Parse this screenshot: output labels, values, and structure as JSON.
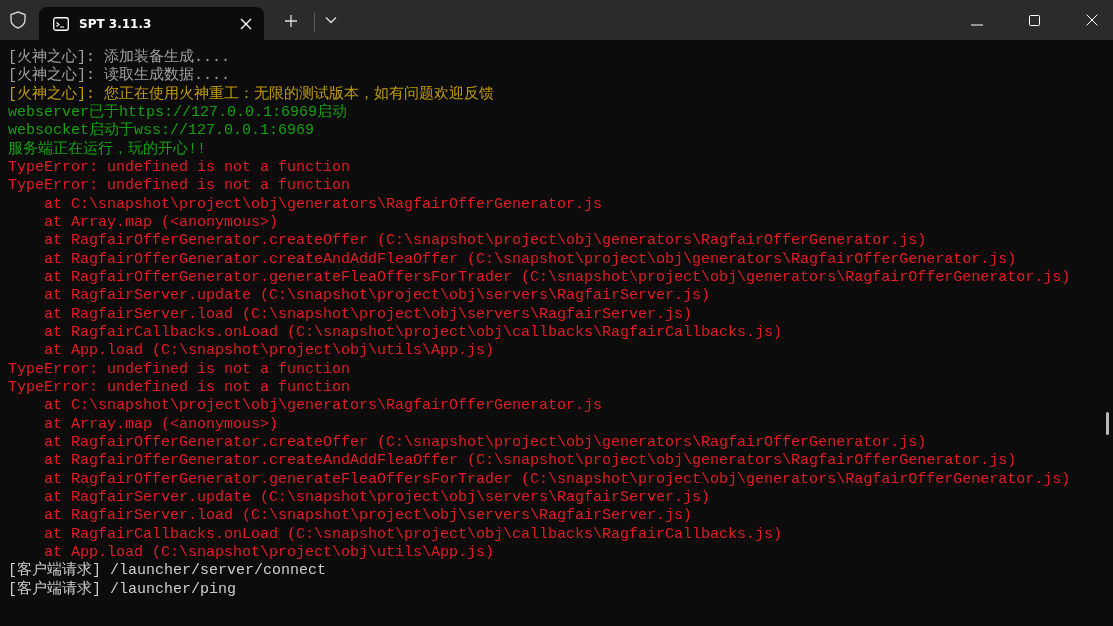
{
  "window": {
    "tabs": [
      {
        "title": "SPT 3.11.3",
        "selected": true
      }
    ]
  },
  "console": {
    "lines": [
      {
        "kind": "info",
        "text": "[火神之心]: 添加装备生成...."
      },
      {
        "kind": "info",
        "text": "[火神之心]: 读取生成数据...."
      },
      {
        "kind": "warn",
        "text": "[火神之心]: 您正在使用火神重工：无限的测试版本，如有问题欢迎反馈"
      },
      {
        "kind": "ok",
        "text": "webserver已于https://127.0.0.1:6969启动"
      },
      {
        "kind": "ok",
        "text": "websocket启动于wss://127.0.0.1:6969"
      },
      {
        "kind": "ok",
        "text": "服务端正在运行，玩的开心!!"
      },
      {
        "kind": "error",
        "text": "TypeError: undefined is not a function"
      },
      {
        "kind": "error",
        "text": "TypeError: undefined is not a function"
      },
      {
        "kind": "stack",
        "text": "at C:\\snapshot\\project\\obj\\generators\\RagfairOfferGenerator.js"
      },
      {
        "kind": "stack",
        "text": "at Array.map (<anonymous>)"
      },
      {
        "kind": "stack",
        "text": "at RagfairOfferGenerator.createOffer (C:\\snapshot\\project\\obj\\generators\\RagfairOfferGenerator.js)"
      },
      {
        "kind": "stack",
        "text": "at RagfairOfferGenerator.createAndAddFleaOffer (C:\\snapshot\\project\\obj\\generators\\RagfairOfferGenerator.js)"
      },
      {
        "kind": "stack",
        "text": "at RagfairOfferGenerator.generateFleaOffersForTrader (C:\\snapshot\\project\\obj\\generators\\RagfairOfferGenerator.js)"
      },
      {
        "kind": "stack",
        "text": "at RagfairServer.update (C:\\snapshot\\project\\obj\\servers\\RagfairServer.js)"
      },
      {
        "kind": "stack",
        "text": "at RagfairServer.load (C:\\snapshot\\project\\obj\\servers\\RagfairServer.js)"
      },
      {
        "kind": "stack",
        "text": "at RagfairCallbacks.onLoad (C:\\snapshot\\project\\obj\\callbacks\\RagfairCallbacks.js)"
      },
      {
        "kind": "stack",
        "text": "at App.load (C:\\snapshot\\project\\obj\\utils\\App.js)"
      },
      {
        "kind": "error",
        "text": "TypeError: undefined is not a function"
      },
      {
        "kind": "error",
        "text": "TypeError: undefined is not a function"
      },
      {
        "kind": "stack",
        "text": "at C:\\snapshot\\project\\obj\\generators\\RagfairOfferGenerator.js"
      },
      {
        "kind": "stack",
        "text": "at Array.map (<anonymous>)"
      },
      {
        "kind": "stack",
        "text": "at RagfairOfferGenerator.createOffer (C:\\snapshot\\project\\obj\\generators\\RagfairOfferGenerator.js)"
      },
      {
        "kind": "stack",
        "text": "at RagfairOfferGenerator.createAndAddFleaOffer (C:\\snapshot\\project\\obj\\generators\\RagfairOfferGenerator.js)"
      },
      {
        "kind": "stack",
        "text": "at RagfairOfferGenerator.generateFleaOffersForTrader (C:\\snapshot\\project\\obj\\generators\\RagfairOfferGenerator.js)"
      },
      {
        "kind": "stack",
        "text": "at RagfairServer.update (C:\\snapshot\\project\\obj\\servers\\RagfairServer.js)"
      },
      {
        "kind": "stack",
        "text": "at RagfairServer.load (C:\\snapshot\\project\\obj\\servers\\RagfairServer.js)"
      },
      {
        "kind": "stack",
        "text": "at RagfairCallbacks.onLoad (C:\\snapshot\\project\\obj\\callbacks\\RagfairCallbacks.js)"
      },
      {
        "kind": "stack",
        "text": "at App.load (C:\\snapshot\\project\\obj\\utils\\App.js)"
      },
      {
        "kind": "plain",
        "text": "[客户端请求] /launcher/server/connect"
      },
      {
        "kind": "plain",
        "text": "[客户端请求] /launcher/ping"
      }
    ]
  }
}
